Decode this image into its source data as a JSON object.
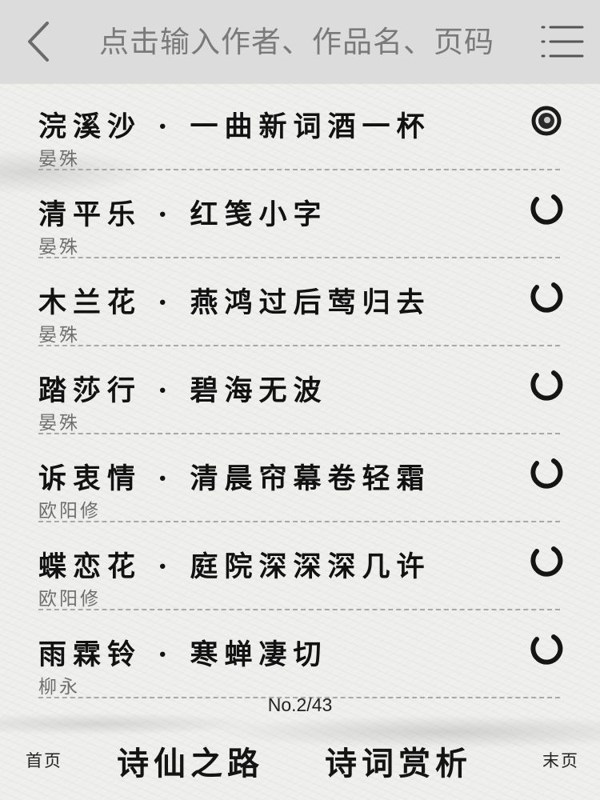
{
  "header": {
    "search_placeholder": "点击输入作者、作品名、页码"
  },
  "list": [
    {
      "title": "浣溪沙 · 一曲新词酒一杯",
      "author": "晏殊",
      "state": "filled"
    },
    {
      "title": "清平乐 · 红笺小字",
      "author": "晏殊",
      "state": "ring"
    },
    {
      "title": "木兰花 · 燕鸿过后莺归去",
      "author": "晏殊",
      "state": "ring"
    },
    {
      "title": "踏莎行 · 碧海无波",
      "author": "晏殊",
      "state": "ring"
    },
    {
      "title": "诉衷情 · 清晨帘幕卷轻霜",
      "author": "欧阳修",
      "state": "ring"
    },
    {
      "title": "蝶恋花 · 庭院深深深几许",
      "author": "欧阳修",
      "state": "ring"
    },
    {
      "title": "雨霖铃 · 寒蝉凄切",
      "author": "柳永",
      "state": "ring"
    }
  ],
  "pagination": {
    "indicator": "No.2/43",
    "first": "首页",
    "last": "末页"
  },
  "footer": {
    "tab_left": "诗仙之路",
    "tab_right": "诗词赏析"
  },
  "icons": [
    "back-arrow-icon",
    "menu-icon",
    "ink-ring-icon"
  ]
}
